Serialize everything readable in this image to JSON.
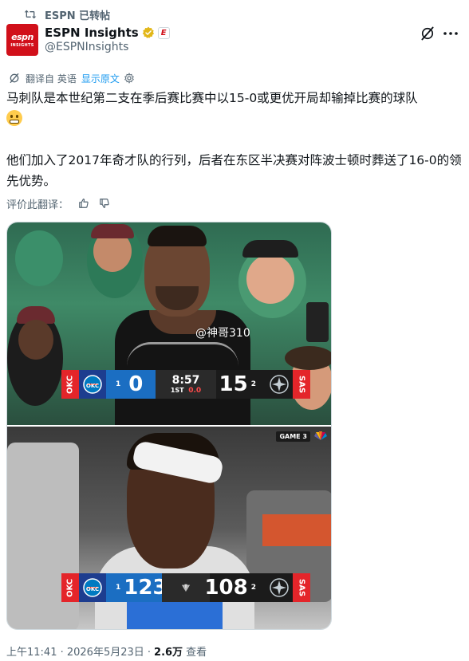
{
  "repost": {
    "label": "ESPN 已转帖"
  },
  "author": {
    "display_name": "ESPN Insights",
    "handle": "@ESPNInsights",
    "avatar_text_top": "espn",
    "avatar_text_bottom": "INSIGHTS",
    "brand_color": "#d1101a",
    "verified_color": "#e2b719"
  },
  "translation": {
    "label": "翻译自 英语",
    "show_original": "显示原文"
  },
  "tweet": {
    "line1": "马刺队是本世纪第二支在季后赛比赛中以15-0或更优开局却输掉比赛的球队",
    "line2": "他们加入了2017年奇才队的行列，后者在东区半决赛对阵波士顿时葬送了16-0的领先优势。",
    "emoji": "grimacing-face"
  },
  "rate_translation": {
    "label": "评价此翻译："
  },
  "media": {
    "watermark": "@神哥310",
    "photo1": {
      "scorebar": {
        "away_abbr": "OKC",
        "away_timeouts": "1",
        "away_score": "0",
        "clock": "8:57",
        "period": "1ST",
        "shot_clock": "0.0",
        "home_timeouts": "2",
        "home_score": "15",
        "home_abbr": "SAS"
      }
    },
    "photo2": {
      "game_badge": "GAME 3",
      "scorebar": {
        "away_abbr": "OKC",
        "away_timeouts": "1",
        "away_score": "123",
        "home_timeouts": "2",
        "home_score": "108",
        "home_abbr": "SAS"
      }
    }
  },
  "footer": {
    "timestamp": "上午11:41 · 2026年5月23日 ·",
    "views_count": "2.6万",
    "views_label": "查看"
  }
}
